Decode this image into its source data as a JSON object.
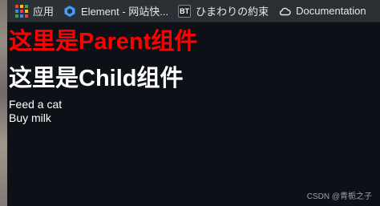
{
  "bookmarks": [
    {
      "label": "应用",
      "icon": "apps-grid-icon"
    },
    {
      "label": "Element - 网站快...",
      "icon": "element-logo-icon"
    },
    {
      "label": "ひまわりの約束",
      "icon": "bt-icon",
      "icon_text": "BT"
    },
    {
      "label": "Documentation",
      "icon": "cloud-icon"
    }
  ],
  "parent": {
    "title": "这里是Parent组件"
  },
  "child": {
    "title": "这里是Child组件",
    "todos": [
      "Feed a cat",
      "Buy milk"
    ]
  },
  "watermark": "CSDN @青栀之子",
  "colors": {
    "background": "#0d1117",
    "bookmarks_bar": "#2b3034",
    "parent_title": "#ff0000",
    "child_title": "#ffffff"
  }
}
